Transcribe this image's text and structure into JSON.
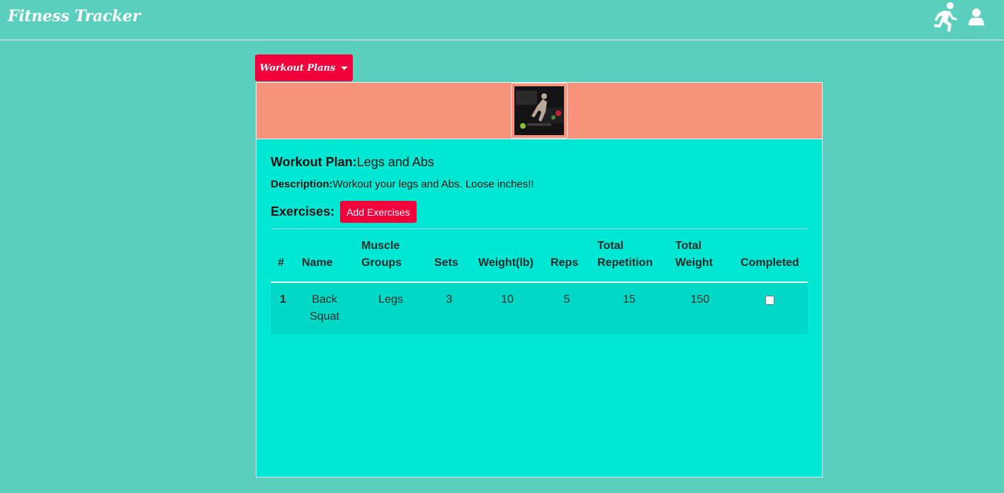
{
  "navbar": {
    "brand": "Fitness Tracker",
    "icons": [
      "running-icon",
      "user-icon"
    ]
  },
  "dropdown": {
    "label": "Workout Plans"
  },
  "plan": {
    "title_label": "Workout Plan:",
    "title_value": "Legs and Abs",
    "desc_label": "Description:",
    "desc_value": "Workout your legs and Abs. Loose inches!!",
    "exercises_label": "Exercises:",
    "add_button": "Add Exercises"
  },
  "table": {
    "headers": [
      "#",
      "Name",
      "Muscle Groups",
      "Sets",
      "Weight(lb)",
      "Reps",
      "Total Repetition",
      "Total Weight",
      "Completed"
    ],
    "rows": [
      {
        "index": "1",
        "name": "Back Squat",
        "muscle_groups": "Legs",
        "sets": "3",
        "weight": "10",
        "reps": "5",
        "total_repetition": "15",
        "total_weight": "150",
        "completed": false
      }
    ]
  },
  "colors": {
    "page_bg": "#5acfbd",
    "accent": "#f2003c",
    "card_bg": "#00e8d4",
    "card_header_bg": "#f7937a"
  }
}
